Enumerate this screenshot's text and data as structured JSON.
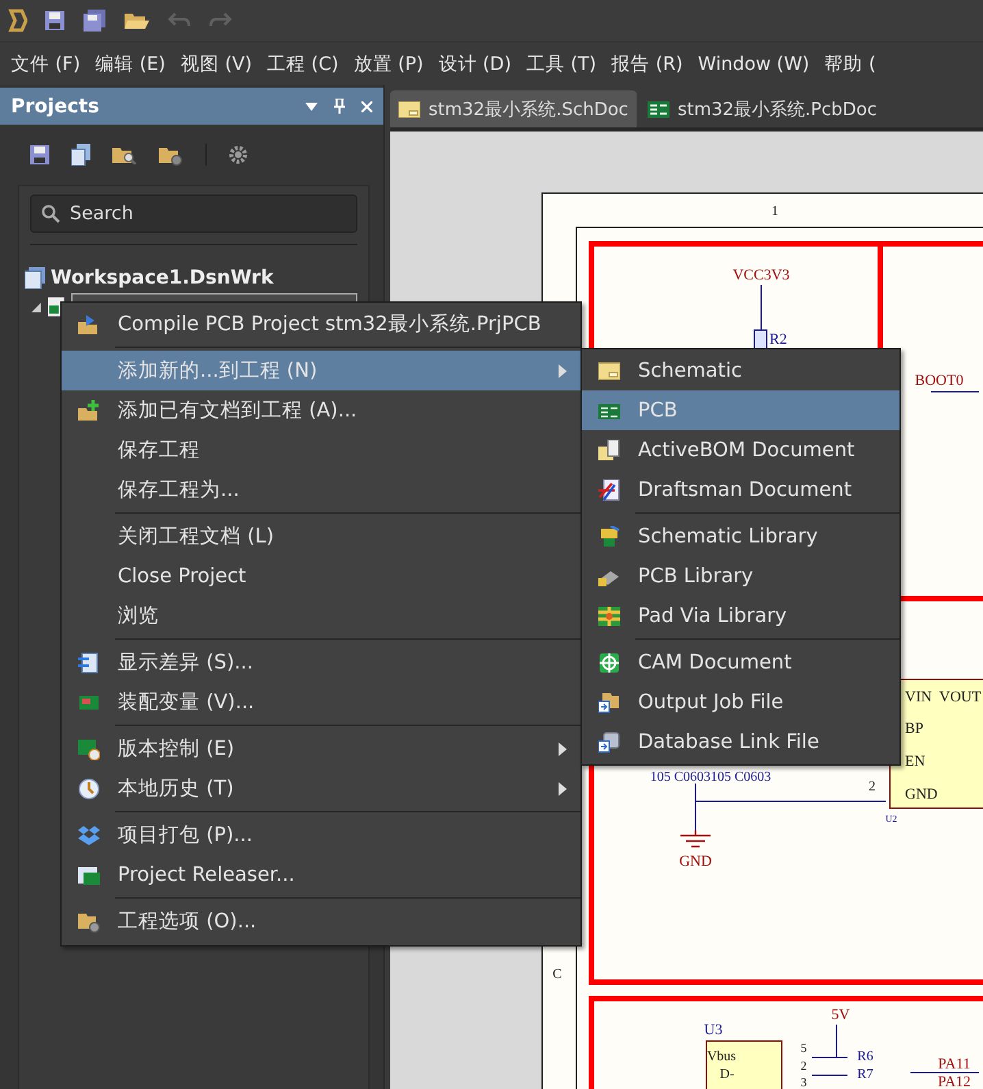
{
  "quick_access": [
    {
      "kind": "logo",
      "disabled": false
    },
    {
      "kind": "save",
      "disabled": false
    },
    {
      "kind": "save_all",
      "disabled": false
    },
    {
      "kind": "open",
      "disabled": false
    },
    {
      "kind": "undo",
      "disabled": true
    },
    {
      "kind": "redo",
      "disabled": true
    }
  ],
  "menu_bar": [
    "文件 (F)",
    "编辑 (E)",
    "视图 (V)",
    "工程 (C)",
    "放置 (P)",
    "设计 (D)",
    "工具 (T)",
    "报告 (R)",
    "Window (W)",
    "帮助 ("
  ],
  "panel": {
    "title": "Projects",
    "search": {
      "placeholder": "Search"
    },
    "tree": {
      "label": "Workspace1.DsnWrk",
      "children": [
        {
          "selected": true,
          "expanded": true
        }
      ]
    }
  },
  "doc_tabs": [
    {
      "label": "stm32最小系统.SchDoc",
      "kind": "schematic",
      "selected": true
    },
    {
      "label": "stm32最小系统.PcbDoc",
      "kind": "pcb",
      "selected": false
    }
  ],
  "schematic": {
    "texts": [
      "1",
      "VCC3V3",
      "R2",
      "BOOT0",
      "VIN",
      "VOUT",
      "BP",
      "EN",
      "GND",
      "U2",
      "105 C0603105 C0603",
      "2",
      "GND",
      "C",
      "U3",
      "5V",
      "Vbus",
      "D-",
      "5",
      "2",
      "3",
      "R6",
      "R7",
      "PA11",
      "PA12"
    ]
  },
  "context_menu": [
    {
      "kind": "item",
      "label": "Compile PCB Project stm32最小系统.PrjPCB",
      "submenu": false,
      "selected": false
    },
    {
      "kind": "separator"
    },
    {
      "kind": "item",
      "label": "添加新的...到工程 (N)",
      "submenu": true,
      "selected": true
    },
    {
      "kind": "item",
      "label": "添加已有文档到工程 (A)...",
      "submenu": false,
      "selected": false
    },
    {
      "kind": "item",
      "label": "保存工程",
      "submenu": false,
      "selected": false
    },
    {
      "kind": "item",
      "label": "保存工程为...",
      "submenu": false,
      "selected": false
    },
    {
      "kind": "separator"
    },
    {
      "kind": "item",
      "label": "关闭工程文档 (L)",
      "submenu": false,
      "selected": false
    },
    {
      "kind": "item",
      "label": "Close Project",
      "submenu": false,
      "selected": false
    },
    {
      "kind": "item",
      "label": "浏览",
      "submenu": false,
      "selected": false
    },
    {
      "kind": "separator"
    },
    {
      "kind": "item",
      "label": "显示差异 (S)...",
      "submenu": false,
      "selected": false
    },
    {
      "kind": "item",
      "label": "装配变量 (V)...",
      "submenu": false,
      "selected": false
    },
    {
      "kind": "separator"
    },
    {
      "kind": "item",
      "label": "版本控制 (E)",
      "submenu": true,
      "selected": false
    },
    {
      "kind": "item",
      "label": "本地历史 (T)",
      "submenu": true,
      "selected": false
    },
    {
      "kind": "separator"
    },
    {
      "kind": "item",
      "label": "项目打包 (P)...",
      "submenu": false,
      "selected": false
    },
    {
      "kind": "item",
      "label": "Project Releaser...",
      "submenu": false,
      "selected": false
    },
    {
      "kind": "separator"
    },
    {
      "kind": "item",
      "label": "工程选项 (O)...",
      "submenu": false,
      "selected": false
    }
  ],
  "submenu": [
    {
      "kind": "item",
      "label": "Schematic",
      "selected": false
    },
    {
      "kind": "item",
      "label": "PCB",
      "selected": true
    },
    {
      "kind": "item",
      "label": "ActiveBOM Document",
      "selected": false
    },
    {
      "kind": "item",
      "label": "Draftsman Document",
      "selected": false
    },
    {
      "kind": "separator"
    },
    {
      "kind": "item",
      "label": "Schematic Library",
      "selected": false
    },
    {
      "kind": "item",
      "label": "PCB Library",
      "selected": false
    },
    {
      "kind": "item",
      "label": "Pad Via Library",
      "selected": false
    },
    {
      "kind": "separator"
    },
    {
      "kind": "item",
      "label": "CAM Document",
      "selected": false
    },
    {
      "kind": "item",
      "label": "Output Job File",
      "selected": false
    },
    {
      "kind": "item",
      "label": "Database Link File",
      "selected": false
    }
  ]
}
